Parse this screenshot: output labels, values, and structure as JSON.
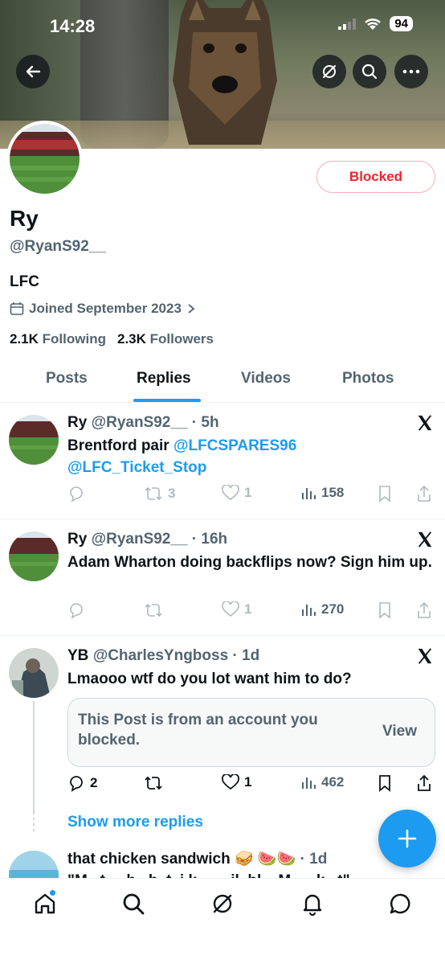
{
  "status_bar": {
    "time": "14:28",
    "battery": "94"
  },
  "profile": {
    "name": "Ry",
    "handle": "@RyanS92__",
    "bio": "LFC",
    "joined": "Joined September 2023",
    "following_count": "2.1K",
    "following_label": "Following",
    "followers_count": "2.3K",
    "followers_label": "Followers",
    "blocked_label": "Blocked"
  },
  "tabs": [
    {
      "label": "Posts"
    },
    {
      "label": "Replies"
    },
    {
      "label": "Videos"
    },
    {
      "label": "Photos"
    }
  ],
  "active_tab": "Replies",
  "posts": [
    {
      "name": "Ry",
      "handle": "@RyanS92__",
      "time": "5h",
      "text": "Brentford pair ",
      "mentions": [
        "@LFCSPARES96",
        "@LFC_Ticket_Stop"
      ],
      "replies": "",
      "reposts": "3",
      "likes": "1",
      "views": "158"
    },
    {
      "name": "Ry",
      "handle": "@RyanS92__",
      "time": "16h",
      "text": "Adam Wharton doing backflips now? Sign him up.",
      "replies": "",
      "reposts": "",
      "likes": "1",
      "views": "270"
    },
    {
      "name": "YB",
      "handle": "@CharlesYngboss",
      "time": "1d",
      "text": "Lmaooo wtf do you lot want him to do?",
      "quote_text": "This Post is from an account you blocked.",
      "quote_action": "View",
      "replies": "2",
      "reposts": "",
      "likes": "1",
      "views": "462"
    }
  ],
  "show_more_label": "Show more replies",
  "next_post": {
    "name": "that chicken sandwich 🥪 🍉🍉",
    "time": "1d",
    "text_partial": "\"M...t.....h...b..t..i.k........il..bl....M......k...t\""
  },
  "colors": {
    "accent": "#1d9bf0",
    "blocked": "#f4212e",
    "secondary_text": "#536471"
  },
  "icons": [
    "back-arrow-icon",
    "grok-icon",
    "search-icon",
    "more-icon",
    "calendar-icon",
    "chevron-right-icon",
    "x-logo-icon",
    "reply-icon",
    "repost-icon",
    "like-icon",
    "views-icon",
    "bookmark-icon",
    "share-icon",
    "plus-icon",
    "home-icon",
    "nav-search-icon",
    "nav-grok-icon",
    "bell-icon",
    "messages-icon"
  ]
}
